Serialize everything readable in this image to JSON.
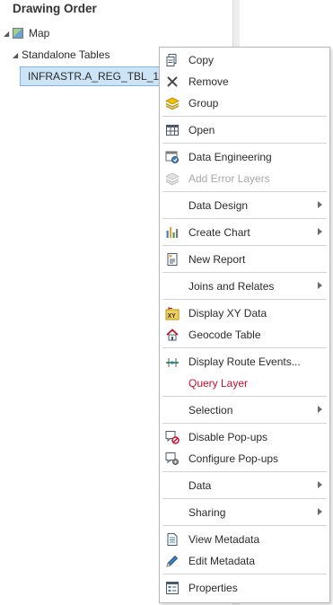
{
  "pane": {
    "title": "Drawing Order",
    "map_label": "Map",
    "standalone_label": "Standalone Tables",
    "selected_table": "INFRASTR.A_REG_TBL_1"
  },
  "menu": {
    "copy": "Copy",
    "remove": "Remove",
    "group": "Group",
    "open": "Open",
    "data_engineering": "Data Engineering",
    "add_error_layers": "Add Error Layers",
    "data_design": "Data Design",
    "create_chart": "Create Chart",
    "new_report": "New Report",
    "joins_relates": "Joins and Relates",
    "display_xy": "Display XY Data",
    "geocode_table": "Geocode Table",
    "display_route_events": "Display Route Events...",
    "query_layer": "Query Layer",
    "selection": "Selection",
    "disable_popups": "Disable Pop-ups",
    "configure_popups": "Configure Pop-ups",
    "data": "Data",
    "sharing": "Sharing",
    "view_metadata": "View Metadata",
    "edit_metadata": "Edit Metadata",
    "properties": "Properties"
  },
  "icons": {
    "copy": "copy-icon",
    "remove": "remove-x-icon",
    "group": "group-layers-icon",
    "open": "table-icon",
    "data_engineering": "data-engineering-icon",
    "add_error_layers": "error-layers-icon",
    "create_chart": "bar-chart-icon",
    "new_report": "report-icon",
    "display_xy": "xy-data-icon",
    "geocode_table": "geocode-house-icon",
    "display_route_events": "route-events-icon",
    "disable_popups": "disable-popup-icon",
    "configure_popups": "configure-popup-icon",
    "view_metadata": "metadata-document-icon",
    "edit_metadata": "pencil-icon",
    "properties": "properties-icon"
  },
  "colors": {
    "selection_bg": "#cde4f7",
    "selection_border": "#7eb4ea",
    "query_layer_text": "#c8102e",
    "disabled_text": "#a8a8a8"
  }
}
